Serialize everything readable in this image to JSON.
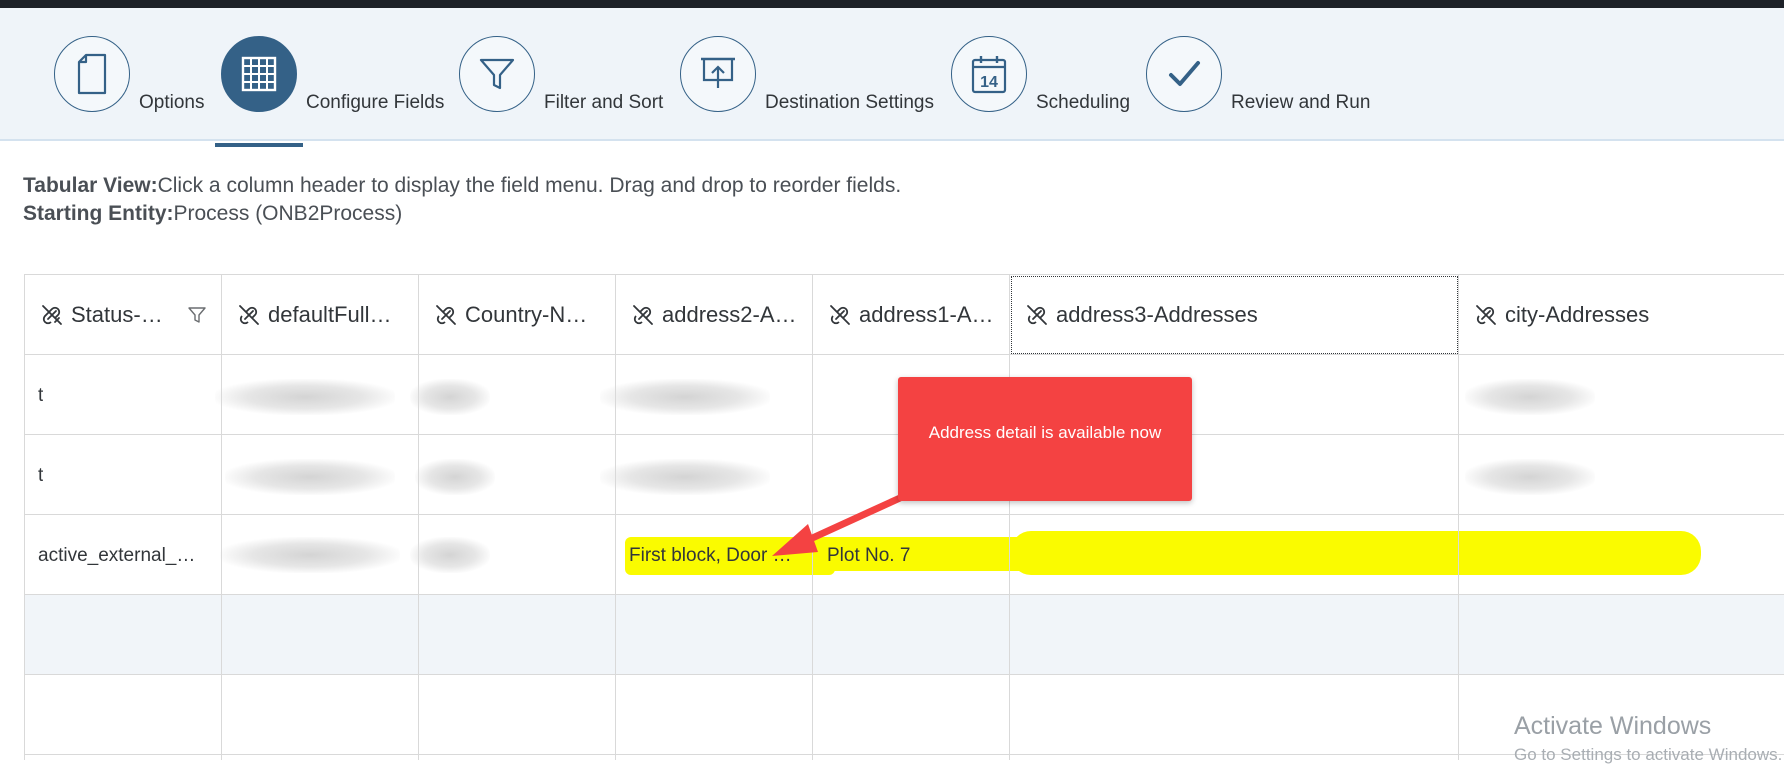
{
  "wizard": {
    "steps": [
      {
        "label": "Options",
        "icon": "document-icon",
        "active": false
      },
      {
        "label": "Configure Fields",
        "icon": "table-grid-icon",
        "active": true
      },
      {
        "label": "Filter and Sort",
        "icon": "filter-icon",
        "active": false
      },
      {
        "label": "Destination Settings",
        "icon": "presentation-upload-icon",
        "active": false
      },
      {
        "label": "Scheduling",
        "icon": "calendar-icon",
        "calendar_day": "14",
        "active": false
      },
      {
        "label": "Review and Run",
        "icon": "checkmark-icon",
        "active": false
      }
    ]
  },
  "instructions": {
    "tabular_label": "Tabular View:",
    "tabular_text": "Click a column header to display the field menu. Drag and drop to reorder fields.",
    "entity_label": "Starting Entity:",
    "entity_text": "Process (ONB2Process)"
  },
  "table": {
    "columns": [
      "Status-…",
      "defaultFull…",
      "Country-N…",
      "address2-A…",
      "address1-A…",
      "address3-Addresses",
      "city-Addresses"
    ],
    "rows": [
      {
        "status": "t"
      },
      {
        "status": "t"
      },
      {
        "status": "active_external_…",
        "address2": "First block, Door …",
        "address1": "Plot No. 7"
      }
    ]
  },
  "callout": {
    "text": "Address detail is available now"
  },
  "watermark": {
    "title": "Activate Windows",
    "subtitle": "Go to Settings to activate Windows."
  },
  "colors": {
    "accent": "#346187",
    "callout": "#f44242",
    "highlight": "#fafb00"
  }
}
